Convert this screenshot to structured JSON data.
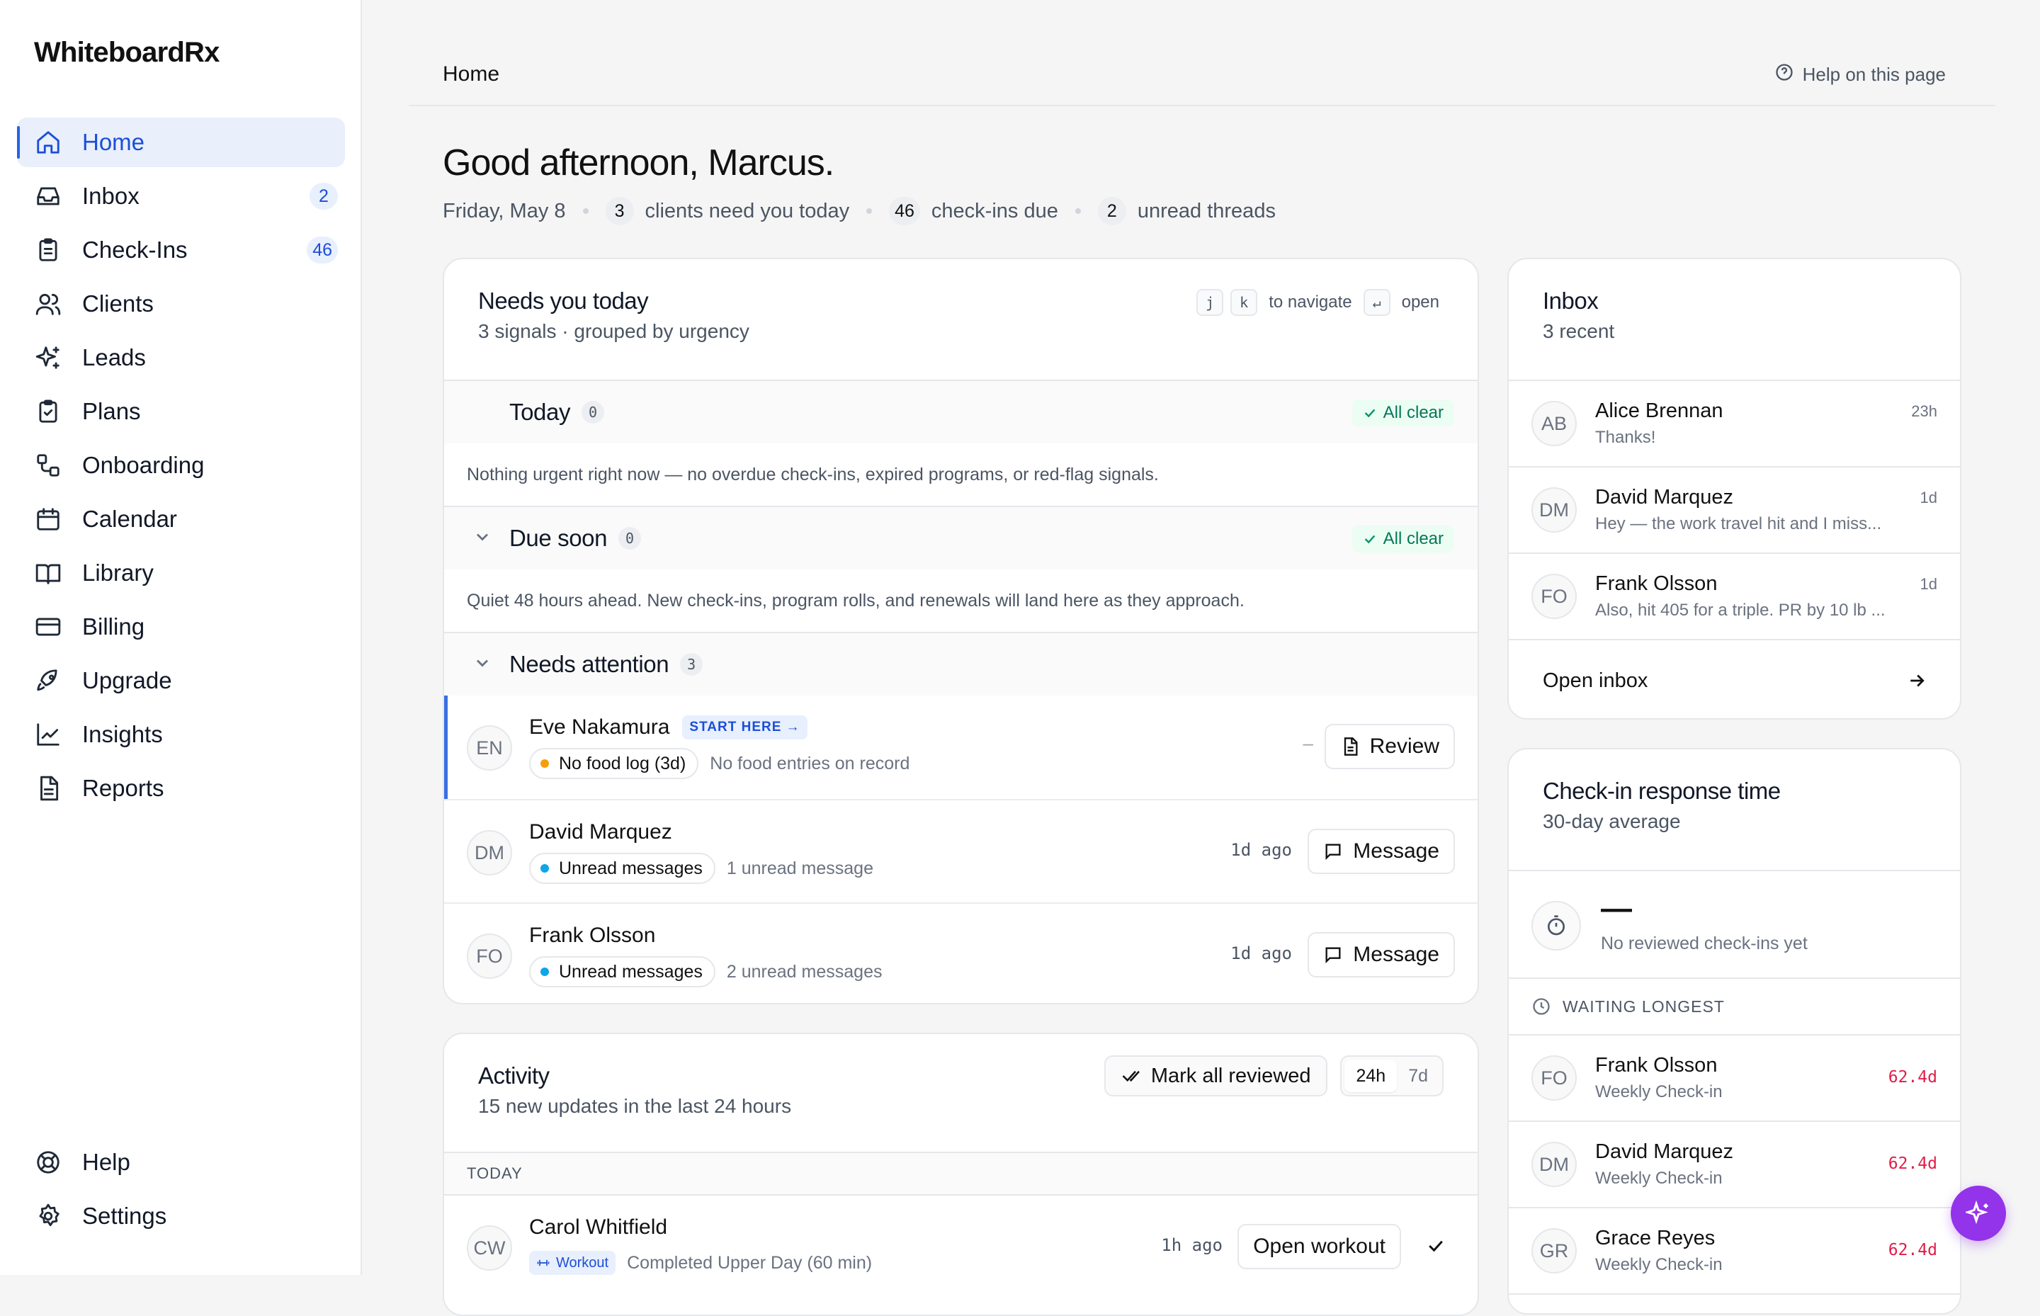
{
  "app": {
    "brand": "WhiteboardRx"
  },
  "sidebar": {
    "items": [
      {
        "label": "Home",
        "icon": "home-icon",
        "active": true
      },
      {
        "label": "Inbox",
        "icon": "inbox-icon",
        "badge": "2"
      },
      {
        "label": "Check-Ins",
        "icon": "clipboard-icon",
        "badge": "46"
      },
      {
        "label": "Clients",
        "icon": "users-icon"
      },
      {
        "label": "Leads",
        "icon": "sparkles-icon"
      },
      {
        "label": "Plans",
        "icon": "clipboard-check-icon"
      },
      {
        "label": "Onboarding",
        "icon": "workflow-icon"
      },
      {
        "label": "Calendar",
        "icon": "calendar-icon"
      },
      {
        "label": "Library",
        "icon": "book-icon"
      },
      {
        "label": "Billing",
        "icon": "credit-card-icon"
      },
      {
        "label": "Upgrade",
        "icon": "rocket-icon"
      },
      {
        "label": "Insights",
        "icon": "line-chart-icon"
      },
      {
        "label": "Reports",
        "icon": "file-text-icon"
      }
    ],
    "bottom": [
      {
        "label": "Help",
        "icon": "life-buoy-icon"
      },
      {
        "label": "Settings",
        "icon": "gear-icon"
      }
    ]
  },
  "header": {
    "breadcrumb": "Home",
    "help": "Help on this page"
  },
  "greeting": {
    "title": "Good afternoon, Marcus.",
    "date": "Friday, May 8",
    "stats": [
      {
        "num": "3",
        "label": "clients need you today"
      },
      {
        "num": "46",
        "label": "check-ins due"
      },
      {
        "num": "2",
        "label": "unread threads"
      }
    ]
  },
  "needs": {
    "title": "Needs you today",
    "subtitle": "3 signals · grouped by urgency",
    "hint": {
      "k1": "j",
      "k2": "k",
      "navigate": "to navigate",
      "k3": "↵",
      "open": "open"
    },
    "groups": [
      {
        "title": "Today",
        "count": "0",
        "status": "All clear",
        "note": "Nothing urgent right now — no overdue check-ins, expired programs, or red-flag signals."
      },
      {
        "title": "Due soon",
        "count": "0",
        "status": "All clear",
        "note": "Quiet 48 hours ahead. New check-ins, program rolls, and renewals will land here as they approach."
      },
      {
        "title": "Needs attention",
        "count": "3"
      }
    ],
    "rows": [
      {
        "initials": "EN",
        "name": "Eve Nakamura",
        "tag": "START HERE →",
        "chip": "No food log (3d)",
        "chip_color": "#f59e0b",
        "detail": "No food entries on record",
        "age": "–",
        "action": "Review"
      },
      {
        "initials": "DM",
        "name": "David Marquez",
        "chip": "Unread messages",
        "chip_color": "#0ea5e9",
        "detail": "1 unread message",
        "age": "1d ago",
        "action": "Message"
      },
      {
        "initials": "FO",
        "name": "Frank Olsson",
        "chip": "Unread messages",
        "chip_color": "#0ea5e9",
        "detail": "2 unread messages",
        "age": "1d ago",
        "action": "Message"
      }
    ]
  },
  "activity": {
    "title": "Activity",
    "subtitle": "15 new updates in the last 24 hours",
    "mark_all": "Mark all reviewed",
    "range": [
      "24h",
      "7d"
    ],
    "section": "TODAY",
    "items": [
      {
        "initials": "CW",
        "name": "Carol Whitfield",
        "tag": "Workout",
        "detail": "Completed Upper Day (60 min)",
        "age": "1h ago",
        "action": "Open workout"
      }
    ]
  },
  "inbox": {
    "title": "Inbox",
    "subtitle": "3 recent",
    "messages": [
      {
        "initials": "AB",
        "name": "Alice Brennan",
        "preview": "Thanks!",
        "time": "23h"
      },
      {
        "initials": "DM",
        "name": "David Marquez",
        "preview": "Hey — the work travel hit and I miss...",
        "time": "1d"
      },
      {
        "initials": "FO",
        "name": "Frank Olsson",
        "preview": "Also, hit 405 for a triple. PR by 10 lb ...",
        "time": "1d"
      }
    ],
    "open": "Open inbox"
  },
  "response": {
    "title": "Check-in response time",
    "subtitle": "30-day average",
    "value": "—",
    "value_sub": "No reviewed check-ins yet",
    "waiting_label": "WAITING LONGEST",
    "waiting": [
      {
        "initials": "FO",
        "name": "Frank Olsson",
        "type": "Weekly Check-in",
        "time": "62.4d"
      },
      {
        "initials": "DM",
        "name": "David Marquez",
        "type": "Weekly Check-in",
        "time": "62.4d"
      },
      {
        "initials": "GR",
        "name": "Grace Reyes",
        "type": "Weekly Check-in",
        "time": "62.4d"
      }
    ]
  }
}
